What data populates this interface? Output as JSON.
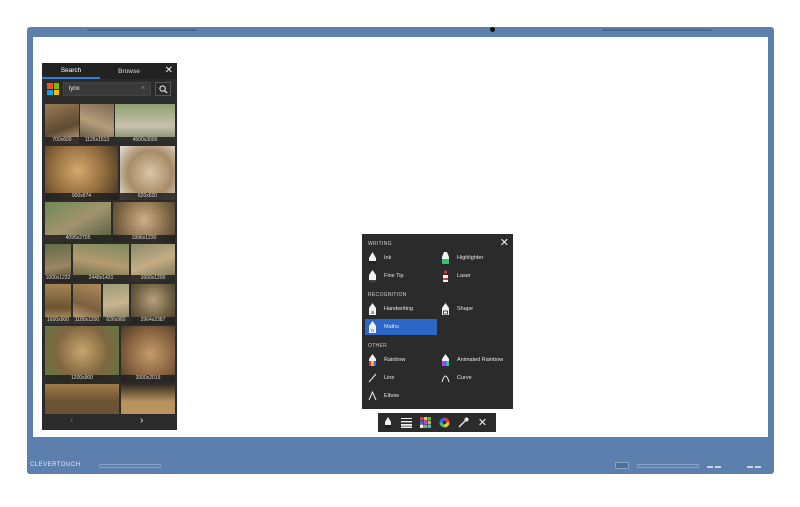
{
  "bezel": {
    "brand": "CLEVERTOUCH"
  },
  "search_panel": {
    "tabs": [
      {
        "label": "Search",
        "active": true
      },
      {
        "label": "Browse",
        "active": false
      }
    ],
    "close_icon": "close-icon",
    "query": "lynx",
    "clear_symbol": "×",
    "results": [
      {
        "caption": "700x600"
      },
      {
        "caption": "1125x1513"
      },
      {
        "caption": "4500x3000"
      },
      {
        "caption": "900x674"
      },
      {
        "caption": "620x620"
      },
      {
        "caption": "4095x2705"
      },
      {
        "caption": "1996x1230"
      },
      {
        "caption": "1000x1232"
      },
      {
        "caption": "2448x1431"
      },
      {
        "caption": "1600x1200"
      },
      {
        "caption": "1600x900"
      },
      {
        "caption": "1180x1200"
      },
      {
        "caption": "626x960"
      },
      {
        "caption": "2964x2387"
      },
      {
        "caption": "1200x900"
      },
      {
        "caption": "2000x2019"
      },
      {
        "caption": ""
      },
      {
        "caption": ""
      }
    ],
    "pager": {
      "prev": "‹",
      "next": "›"
    }
  },
  "pen_menu": {
    "sections": {
      "writing": "WRITING",
      "recognition": "RECOGNITION",
      "other": "OTHER"
    },
    "items": {
      "ink": "Ink",
      "highlighter": "Highlighter",
      "fine_tip": "Fine Tip",
      "laser": "Laser",
      "handwriting": "Handwriting",
      "shape": "Shape",
      "maths": "Maths",
      "rainbow": "Rainbow",
      "animated_rainbow": "Animated Rainbow",
      "line": "Line",
      "curve": "Curve",
      "elbow": "Elbow"
    },
    "selected": "maths"
  },
  "taskbar": {
    "current_page": "4",
    "separator": "|",
    "total_pages": "4"
  },
  "colors": {
    "bezel": "#5c7fae",
    "panel": "#2b2b2b",
    "accent": "#2c67c7",
    "pen_white": "#f2f2f2",
    "pen_purple": "#6b2fd6",
    "pen_green": "#2fc46b",
    "pen_pink": "#f2a2c0"
  }
}
